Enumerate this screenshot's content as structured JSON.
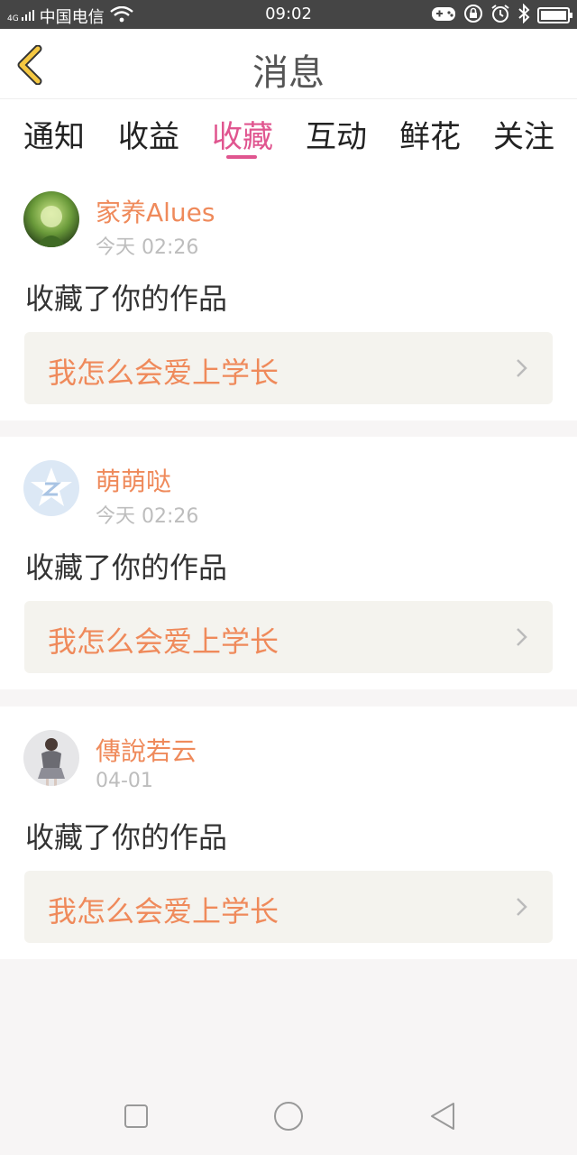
{
  "status_bar": {
    "network_label": "4G",
    "carrier": "中国电信",
    "time": "09:02",
    "battery_level": 1.0,
    "icons": [
      "signal-icon",
      "wifi-icon",
      "gamepad-icon",
      "lock-rotation-icon",
      "alarm-icon",
      "bluetooth-icon",
      "battery-icon"
    ]
  },
  "header": {
    "title": "消息",
    "back_icon": "chevron-left-icon",
    "accent_color": "#f5c842"
  },
  "tabs": [
    {
      "label": "通知"
    },
    {
      "label": "收益"
    },
    {
      "label": "收藏",
      "active": true
    },
    {
      "label": "互动"
    },
    {
      "label": "鲜花"
    },
    {
      "label": "关注"
    }
  ],
  "messages": [
    {
      "user": "家养Alues",
      "time": "今天 02:26",
      "action": "收藏了你的作品",
      "work_title": "我怎么会爱上学长"
    },
    {
      "user": "萌萌哒",
      "time": "今天 02:26",
      "action": "收藏了你的作品",
      "work_title": "我怎么会爱上学长"
    },
    {
      "user": "傳說若云",
      "time": "04-01",
      "action": "收藏了你的作品",
      "work_title": "我怎么会爱上学长"
    }
  ],
  "colors": {
    "accent_pink": "#e0558f",
    "username_orange": "#ef8a5b",
    "work_bg": "#f4f3ee"
  },
  "nav_bar": {
    "icons": [
      "recent-apps-icon",
      "home-icon",
      "back-icon"
    ]
  }
}
